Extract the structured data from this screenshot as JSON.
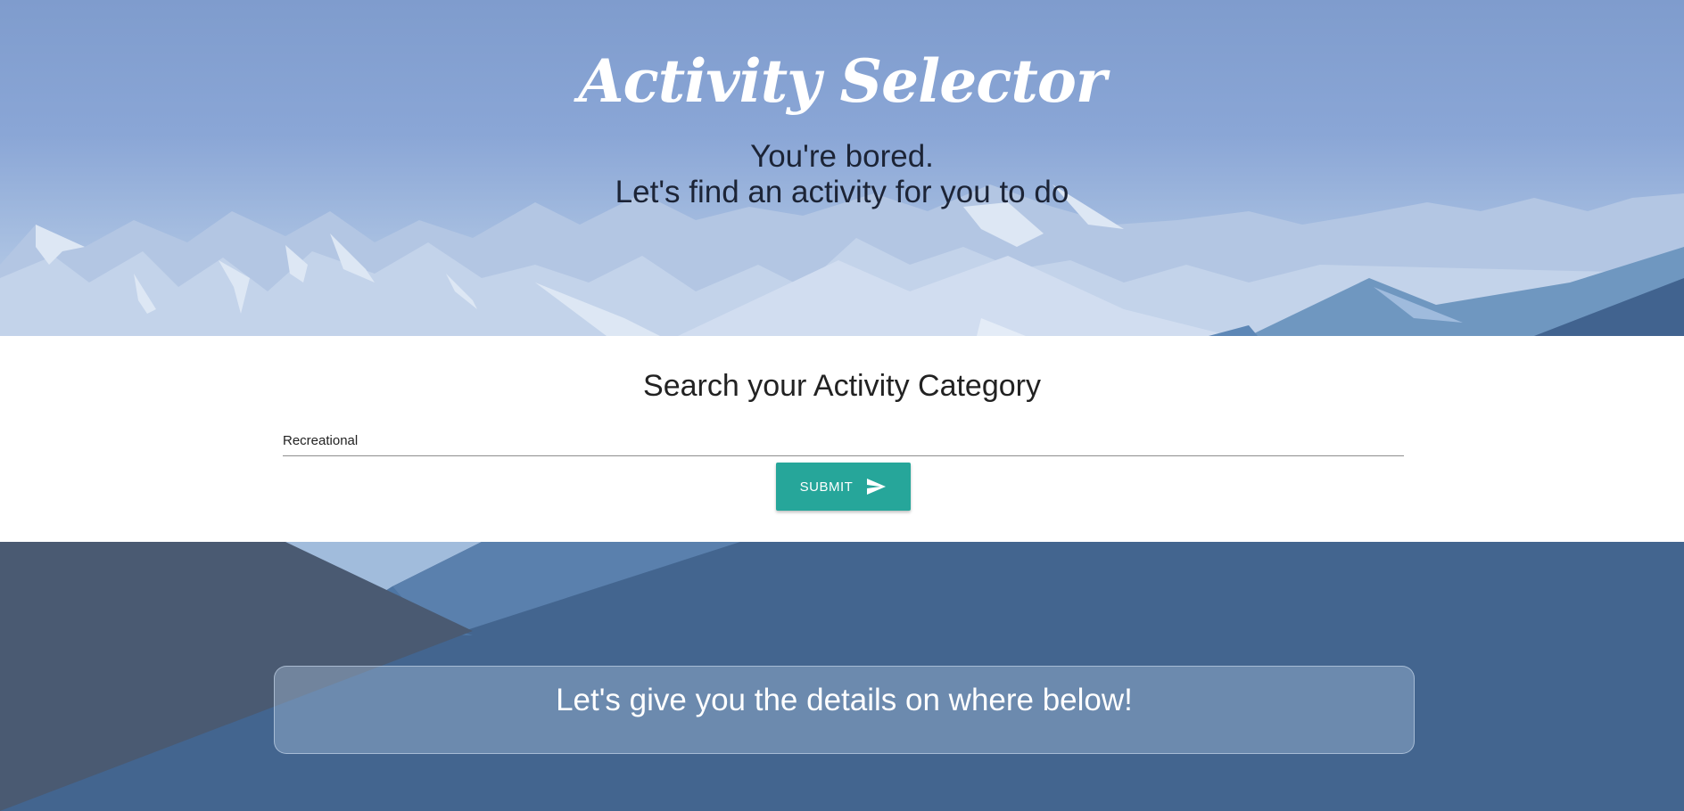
{
  "header": {
    "title": "Activity Selector",
    "subtitle_line1": "You're bored.",
    "subtitle_line2": "Let's find an activity for you to do"
  },
  "search": {
    "heading": "Search your Activity Category",
    "value": "Recreational",
    "submit_label": "SUBMIT",
    "submit_icon": "send-icon"
  },
  "details": {
    "message": "Let's give you the details on where below!"
  },
  "colors": {
    "accent": "#26a69a",
    "sky_top": "#7f9ccd",
    "bottom_bg": "#43658f",
    "dark_slope": "#4a5a72"
  }
}
